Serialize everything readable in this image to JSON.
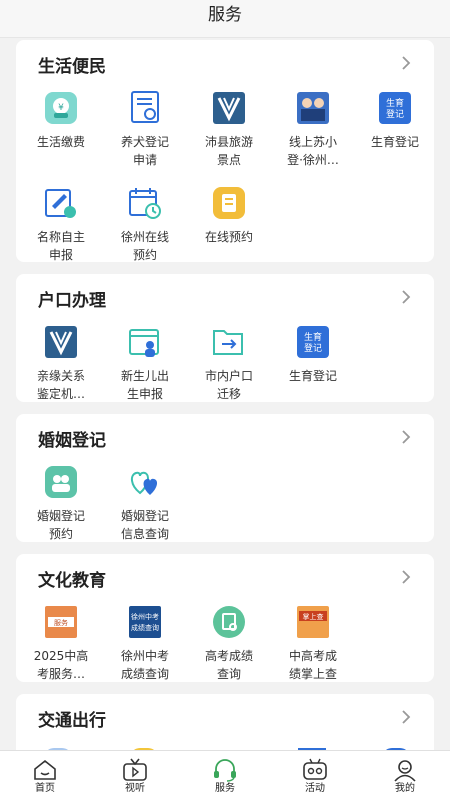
{
  "header": {
    "title": "服务"
  },
  "sections": [
    {
      "title": "生活便民",
      "items": [
        {
          "line1": "生活缴费",
          "line2": "",
          "icon": "wallet-icon"
        },
        {
          "line1": "养犬登记",
          "line2": "申请",
          "icon": "certificate-icon"
        },
        {
          "line1": "沛县旅游",
          "line2": "景点",
          "icon": "v-logo-icon"
        },
        {
          "line1": "线上苏小",
          "line2": "登·徐州…",
          "icon": "staff-avatars-icon"
        },
        {
          "line1": "生育登记",
          "line2": "",
          "icon": "birth-registration-icon",
          "badge1": "生育",
          "badge2": "登记"
        },
        {
          "line1": "名称自主",
          "line2": "申报",
          "icon": "edit-form-icon"
        },
        {
          "line1": "徐州在线",
          "line2": "预约",
          "icon": "calendar-clock-icon"
        },
        {
          "line1": "在线预约",
          "line2": "",
          "icon": "booking-doc-icon"
        }
      ]
    },
    {
      "title": "户口办理",
      "items": [
        {
          "line1": "亲缘关系",
          "line2": "鉴定机…",
          "icon": "v-logo-icon"
        },
        {
          "line1": "新生儿出",
          "line2": "生申报",
          "icon": "newborn-calendar-icon"
        },
        {
          "line1": "市内户口",
          "line2": "迁移",
          "icon": "folder-transfer-icon"
        },
        {
          "line1": "生育登记",
          "line2": "",
          "icon": "birth-registration-icon",
          "badge1": "生育",
          "badge2": "登记"
        }
      ]
    },
    {
      "title": "婚姻登记",
      "items": [
        {
          "line1": "婚姻登记",
          "line2": "预约",
          "icon": "couple-icon"
        },
        {
          "line1": "婚姻登记",
          "line2": "信息查询",
          "icon": "hearts-icon"
        }
      ]
    },
    {
      "title": "文化教育",
      "items": [
        {
          "line1": "2025中高",
          "line2": "考服务…",
          "icon": "exam-banner-icon",
          "badge1": "服务"
        },
        {
          "line1": "徐州中考",
          "line2": "成绩查询",
          "icon": "score-query-banner-icon",
          "badge1": "徐州中考",
          "badge2": "成绩查询"
        },
        {
          "line1": "高考成绩",
          "line2": "查询",
          "icon": "score-search-icon"
        },
        {
          "line1": "中高考成",
          "line2": "绩掌上查",
          "icon": "palm-query-banner-icon",
          "badge1": "掌上查"
        }
      ]
    },
    {
      "title": "交通出行",
      "items": []
    }
  ],
  "tabbar": [
    {
      "label": "首页",
      "icon": "home-icon"
    },
    {
      "label": "视听",
      "icon": "tv-icon"
    },
    {
      "label": "服务",
      "icon": "headset-icon",
      "active": true
    },
    {
      "label": "活动",
      "icon": "activity-icon"
    },
    {
      "label": "我的",
      "icon": "profile-icon"
    }
  ],
  "colors": {
    "accent": "#3aa65a",
    "blue": "#2f6fd8",
    "teal": "#3bbfae"
  }
}
